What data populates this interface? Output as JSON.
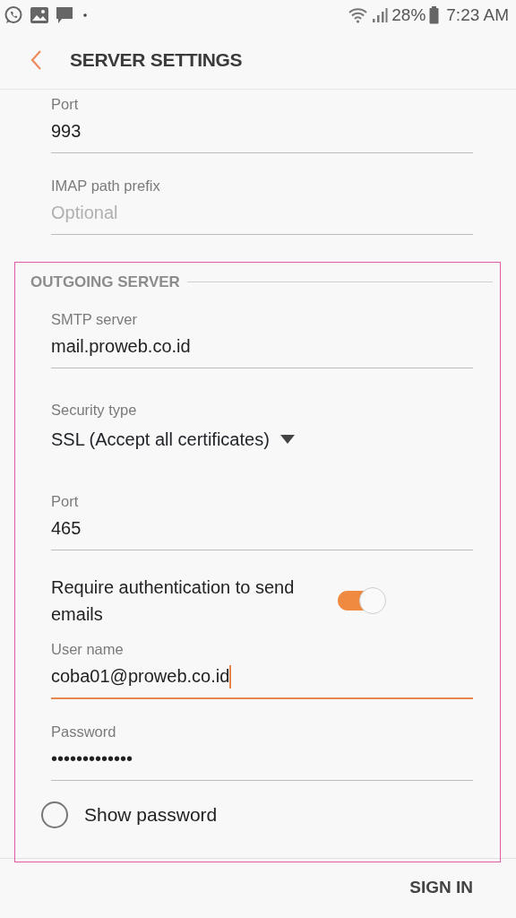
{
  "status_bar": {
    "battery": "28%",
    "time": "7:23 AM"
  },
  "header": {
    "title": "SERVER SETTINGS"
  },
  "fields": [
    {
      "kind": "text",
      "label": "Port",
      "value": "993",
      "focused": false
    },
    {
      "kind": "text",
      "label": "IMAP path prefix",
      "placeholder": "Optional",
      "focused": false
    }
  ],
  "outgoing_section": {
    "title": "OUTGOING SERVER",
    "fields": [
      {
        "kind": "text",
        "label": "SMTP server",
        "value": "mail.proweb.co.id",
        "focused": false
      },
      {
        "kind": "dropdown",
        "label": "Security type",
        "value": "SSL (Accept all certificates)"
      },
      {
        "kind": "text",
        "label": "Port",
        "value": "465",
        "focused": false
      },
      {
        "kind": "switch",
        "label": "Require authentication to send emails",
        "on": true
      },
      {
        "kind": "text",
        "label": "User name",
        "value": "coba01@proweb.co.id",
        "focused": true
      },
      {
        "kind": "text",
        "label": "Password",
        "value": "•••••••••••••",
        "focused": false
      },
      {
        "kind": "radio",
        "label": "Show password",
        "checked": false
      }
    ]
  },
  "footer": {
    "button": "SIGN IN"
  }
}
